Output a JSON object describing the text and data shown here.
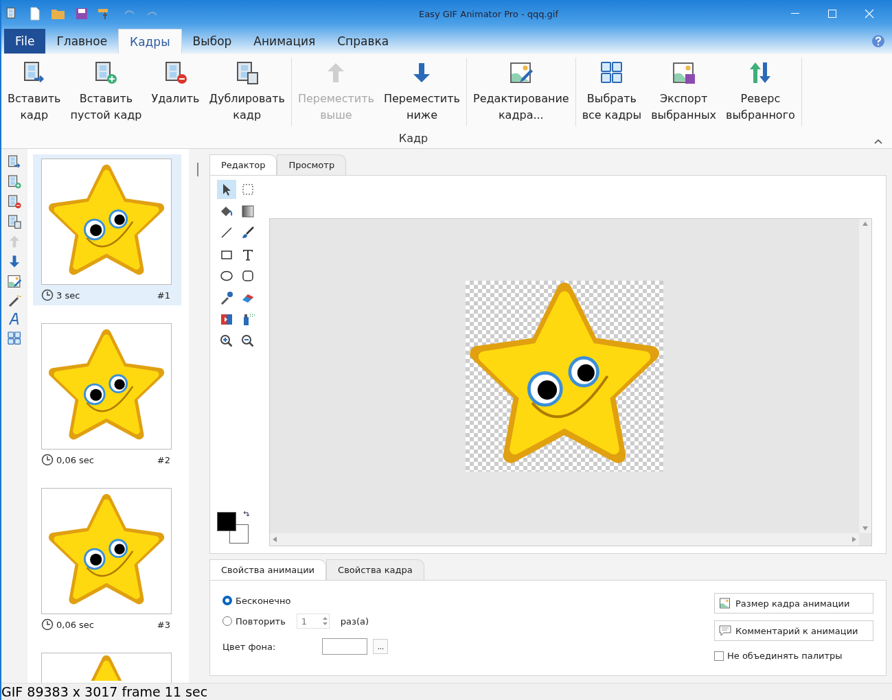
{
  "window": {
    "title": "Easy GIF Animator Pro - qqq.gif"
  },
  "menu_tabs": [
    {
      "label": "File",
      "kind": "file",
      "selected": false
    },
    {
      "label": "Главное",
      "kind": "tab",
      "selected": false
    },
    {
      "label": "Кадры",
      "kind": "tab",
      "selected": true
    },
    {
      "label": "Выбор",
      "kind": "tab",
      "selected": false
    },
    {
      "label": "Анимация",
      "kind": "tab",
      "selected": false
    },
    {
      "label": "Справка",
      "kind": "tab",
      "selected": false
    }
  ],
  "ribbon": {
    "group_label": "Кадр",
    "sections": [
      {
        "buttons": [
          {
            "kind": "insert",
            "label": [
              "Вставить",
              "кадр"
            ],
            "disabled": false
          },
          {
            "kind": "insert-blank",
            "label": [
              "Вставить",
              "пустой кадр"
            ],
            "disabled": false
          },
          {
            "kind": "delete",
            "label": [
              "Удалить"
            ],
            "disabled": false
          },
          {
            "kind": "duplicate",
            "label": [
              "Дублировать",
              "кадр"
            ],
            "disabled": false
          }
        ]
      },
      {
        "buttons": [
          {
            "kind": "up",
            "label": [
              "Переместить",
              "выше"
            ],
            "disabled": true
          },
          {
            "kind": "down",
            "label": [
              "Переместить",
              "ниже"
            ],
            "disabled": false
          }
        ]
      },
      {
        "buttons": [
          {
            "kind": "edit",
            "label": [
              "Редактирование",
              "кадра..."
            ],
            "disabled": false
          }
        ]
      },
      {
        "buttons": [
          {
            "kind": "grid",
            "label": [
              "Выбрать",
              "все кадры"
            ],
            "disabled": false
          },
          {
            "kind": "export",
            "label": [
              "Экспорт",
              "выбранных"
            ],
            "disabled": false
          },
          {
            "kind": "reverse",
            "label": [
              "Реверс",
              "выбранного"
            ],
            "disabled": false
          }
        ]
      }
    ]
  },
  "frames": [
    {
      "duration": "3 sec",
      "number": "#1",
      "selected": true
    },
    {
      "duration": "0,06 sec",
      "number": "#2",
      "selected": false
    },
    {
      "duration": "0,06 sec",
      "number": "#3",
      "selected": false
    },
    {
      "selected": false
    }
  ],
  "editor": {
    "tabs": [
      {
        "label": "Редактор",
        "selected": true
      },
      {
        "label": "Просмотр",
        "selected": false
      }
    ],
    "tools": [
      {
        "kind": "pointer",
        "selected": true
      },
      {
        "kind": "marquee",
        "selected": false
      },
      {
        "kind": "fill",
        "selected": false
      },
      {
        "kind": "gradient",
        "selected": false
      },
      {
        "kind": "line",
        "selected": false
      },
      {
        "kind": "brush",
        "selected": false
      },
      {
        "kind": "rect",
        "selected": false
      },
      {
        "kind": "text",
        "selected": false
      },
      {
        "kind": "ellipse",
        "selected": false
      },
      {
        "kind": "roundrect",
        "selected": false
      },
      {
        "kind": "picker",
        "selected": false
      },
      {
        "kind": "eraser",
        "selected": false
      },
      {
        "kind": "replace",
        "selected": false
      },
      {
        "kind": "spray",
        "selected": false
      },
      {
        "kind": "zoomin",
        "selected": false
      },
      {
        "kind": "zoomout",
        "selected": false
      }
    ]
  },
  "properties": {
    "tabs": [
      {
        "label": "Свойства анимации",
        "selected": true
      },
      {
        "label": "Свойства кадра",
        "selected": false
      }
    ],
    "loop_options": [
      {
        "label": "Бесконечно",
        "selected": true
      },
      {
        "label": "Повторить",
        "selected": false
      }
    ],
    "repeat_count": "1",
    "repeat_suffix": "раз(а)",
    "bg_color_label": "Цвет фона:",
    "browse_button": "...",
    "buttons": [
      {
        "kind": "resize",
        "label": "Размер кадра анимации"
      },
      {
        "kind": "comment",
        "label": "Комментарий к анимации"
      }
    ],
    "no_merge": {
      "label": "Не объединять палитры",
      "checked": false
    }
  },
  "status_bar": "GIF 89383 x 3017 frame 11 sec"
}
